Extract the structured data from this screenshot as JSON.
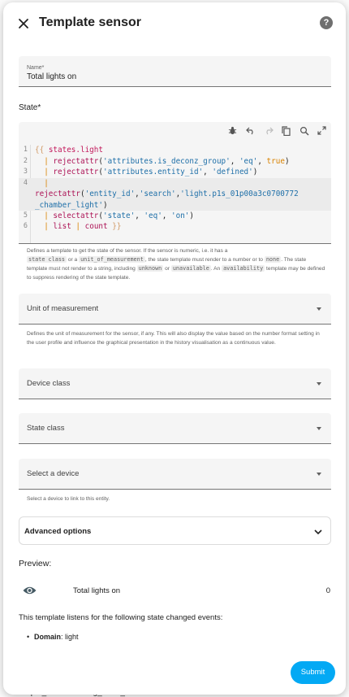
{
  "dialog": {
    "title": "Template sensor",
    "help_glyph": "?"
  },
  "name_field": {
    "label": "Name*",
    "value": "Total lights on"
  },
  "state": {
    "label": "State*",
    "lines": [
      {
        "num": "1"
      },
      {
        "num": "2"
      },
      {
        "num": "3"
      },
      {
        "num": "4"
      },
      {
        "num": "5"
      },
      {
        "num": "6"
      }
    ],
    "tokens": {
      "l1_open": "{{",
      "l1_expr": "states.light",
      "l2_fn": "rejectattr",
      "l2_arg1": "'attributes.is_deconz_group'",
      "l2_arg2": "'eq'",
      "l2_arg3": "true",
      "l3_fn": "rejectattr",
      "l3_arg1": "'attributes.entity_id'",
      "l3_arg2": "'defined'",
      "l4_fn": "rejectattr",
      "l4_arg1": "'entity_id'",
      "l4_arg2": "'search'",
      "l4_arg3a": "'light.p1s_01p00a3c0700772",
      "l4_arg3b": "_chamber_light'",
      "l5_fn": "selectattr",
      "l5_arg1": "'state'",
      "l5_arg2": "'eq'",
      "l5_arg3": "'on'",
      "l6_kw": "list",
      "l6_fn": "count",
      "l6_close": "}}"
    },
    "helper": {
      "p1": "Defines a template to get the state of the sensor. If the sensor is numeric, i.e. it has a",
      "code1": "state class",
      "p2": "or a",
      "code2": "unit_of_measurement",
      "p3": ", the state template must render to a number or to",
      "code3": "none",
      "p4": ". The state template must not render to a string, including",
      "code4": "unknown",
      "p5": "or",
      "code5": "unavailable",
      "p6": ". An",
      "code6": "availability",
      "p7": "template may be defined to suppress rendering of the state template."
    }
  },
  "unit_of_measurement": {
    "label": "Unit of measurement",
    "helper": "Defines the unit of measurement for the sensor, if any. This will also display the value based on the number format setting in the user profile and influence the graphical presentation in the history visualisation as a continuous value."
  },
  "device_class": {
    "label": "Device class"
  },
  "state_class": {
    "label": "State class"
  },
  "device": {
    "label": "Select a device",
    "helper": "Select a device to link to this entity."
  },
  "advanced": {
    "label": "Advanced options"
  },
  "preview": {
    "label": "Preview:",
    "entity_name": "Total lights on",
    "value": "0",
    "listens_text": "This template listens for the following state changed events:",
    "events": [
      {
        "key": "Domain",
        "value": ": light"
      }
    ]
  },
  "submit": {
    "label": "Submit"
  },
  "background": {
    "bottom_text": "input_number.dining_room_eco"
  },
  "colors": {
    "accent": "#03a9f4",
    "primary_text": "#212121",
    "field_bg": "#f5f5f5"
  }
}
